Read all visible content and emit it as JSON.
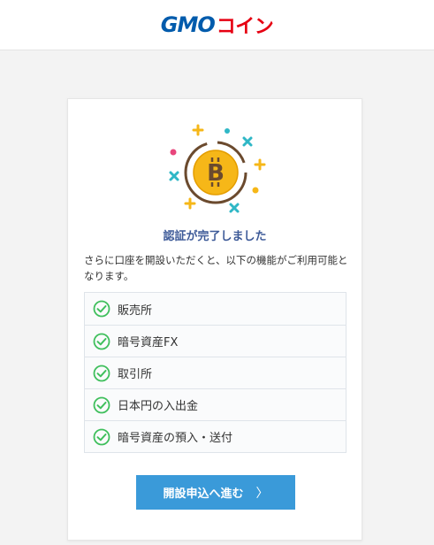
{
  "header": {
    "logo_gmo": "GMO",
    "logo_coin": "コイン"
  },
  "main": {
    "title": "認証が完了しました",
    "description": "さらに口座を開設いただくと、以下の機能がご利用可能となります。",
    "features": [
      {
        "label": "販売所"
      },
      {
        "label": "暗号資産FX"
      },
      {
        "label": "取引所"
      },
      {
        "label": "日本円の入出金"
      },
      {
        "label": "暗号資産の預入・送付"
      }
    ],
    "cta_label": "開設申込へ進む",
    "cta_arrow": "〉"
  },
  "colors": {
    "accent": "#3a9ad9",
    "title": "#3d5a98",
    "check": "#3fbf5c",
    "coin": "#f6b718",
    "brand_blue": "#005bac",
    "brand_red": "#e60012"
  },
  "icons": [
    "bitcoin-icon",
    "check-circle-icon",
    "chevron-right-icon"
  ]
}
